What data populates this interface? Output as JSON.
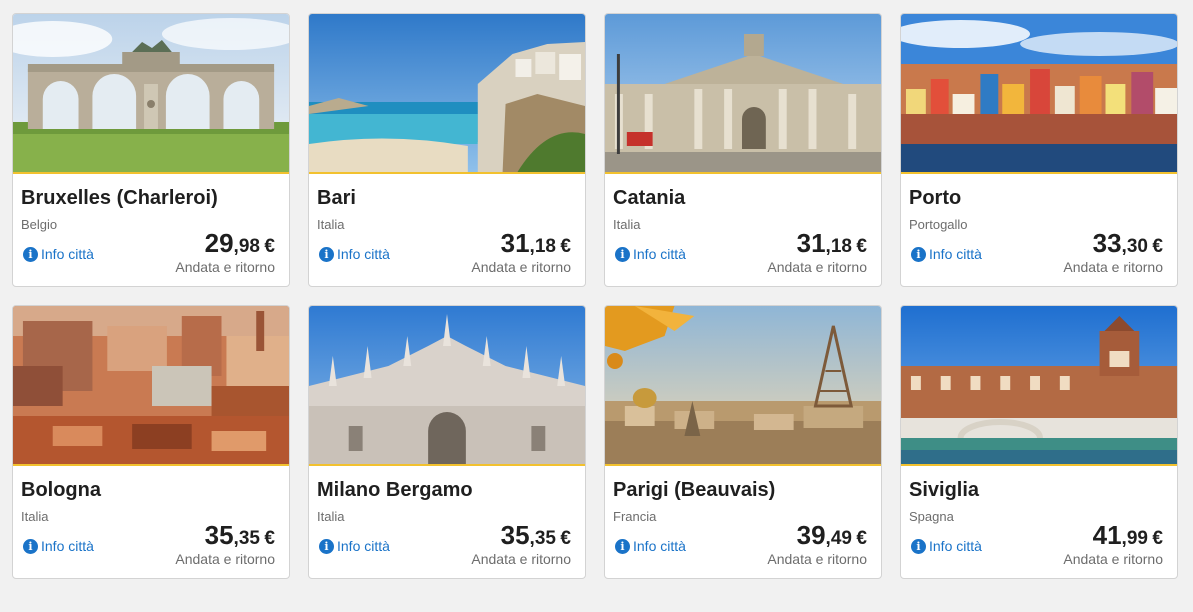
{
  "accent_color": "#f2c12e",
  "link_color": "#1a73c8",
  "cards": [
    {
      "city": "Bruxelles (Charleroi)",
      "country": "Belgio",
      "info": "Info città",
      "price_int": "29",
      "price_sep": ",",
      "price_dec": "98",
      "currency": "€",
      "trip": "Andata e ritorno",
      "image": "arch-monument"
    },
    {
      "city": "Bari",
      "country": "Italia",
      "info": "Info città",
      "price_int": "31",
      "price_sep": ",",
      "price_dec": "18",
      "currency": "€",
      "trip": "Andata e ritorno",
      "image": "coastal-cliff-town"
    },
    {
      "city": "Catania",
      "country": "Italia",
      "info": "Info città",
      "price_int": "31",
      "price_sep": ",",
      "price_dec": "18",
      "currency": "€",
      "trip": "Andata e ritorno",
      "image": "cathedral-square"
    },
    {
      "city": "Porto",
      "country": "Portogallo",
      "info": "Info città",
      "price_int": "33",
      "price_sep": ",",
      "price_dec": "30",
      "currency": "€",
      "trip": "Andata e ritorno",
      "image": "riverside-colorful-houses"
    },
    {
      "city": "Bologna",
      "country": "Italia",
      "info": "Info città",
      "price_int": "35",
      "price_sep": ",",
      "price_dec": "35",
      "currency": "€",
      "trip": "Andata e ritorno",
      "image": "terracotta-rooftops"
    },
    {
      "city": "Milano Bergamo",
      "country": "Italia",
      "info": "Info città",
      "price_int": "35",
      "price_sep": ",",
      "price_dec": "35",
      "currency": "€",
      "trip": "Andata e ritorno",
      "image": "gothic-duomo"
    },
    {
      "city": "Parigi (Beauvais)",
      "country": "Francia",
      "info": "Info città",
      "price_int": "39",
      "price_sep": ",",
      "price_dec": "49",
      "currency": "€",
      "trip": "Andata e ritorno",
      "image": "eiffel-tower-skyline"
    },
    {
      "city": "Siviglia",
      "country": "Spagna",
      "info": "Info città",
      "price_int": "41",
      "price_sep": ",",
      "price_dec": "99",
      "currency": "€",
      "trip": "Andata e ritorno",
      "image": "plaza-bridge-palace"
    }
  ]
}
